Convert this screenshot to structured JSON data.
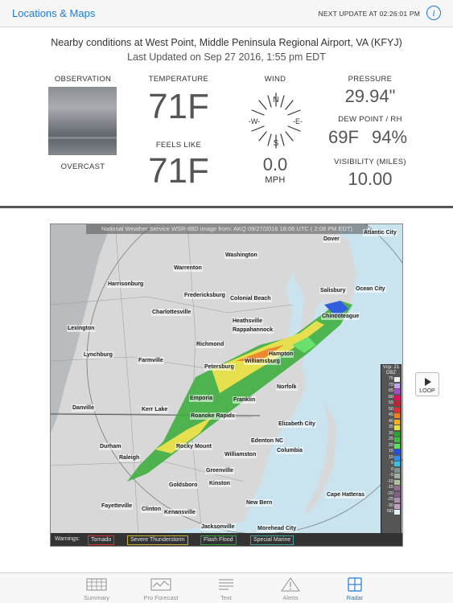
{
  "nav": {
    "back_label": "Locations & Maps",
    "next_update": "NEXT UPDATE AT 02:26:01 PM",
    "info_glyph": "i"
  },
  "conditions": {
    "title": "Nearby conditions at West Point, Middle Peninsula Regional Airport, VA (KFYJ)",
    "last_updated": "Last Updated on Sep 27 2016, 1:55 pm EDT",
    "observation": {
      "label": "OBSERVATION",
      "value": "OVERCAST"
    },
    "temperature": {
      "label": "TEMPERATURE",
      "value": "71F"
    },
    "feels_like": {
      "label": "FEELS LIKE",
      "value": "71F"
    },
    "wind": {
      "label": "WIND",
      "speed": "0.0",
      "unit": "MPH",
      "n": "N",
      "s": "S",
      "e": "-E-",
      "w": "-W-"
    },
    "pressure": {
      "label": "PRESSURE",
      "value": "29.94\""
    },
    "dew_point": {
      "label": "DEW POINT / RH",
      "value": "69F",
      "rh": "94%"
    },
    "visibility": {
      "label": "VISIBILITY (MILES)",
      "value": "10.00"
    }
  },
  "radar": {
    "header": "National Weather Service WSR-88D image from: AKQ 09/27/2016 18:06 UTC ( 2:08 PM EDT)",
    "places": [
      "Dover",
      "Atlantic City",
      "Warrenton",
      "Washington",
      "Harrisonburg",
      "Fredericksburg",
      "Colonial Beach",
      "Salisbury",
      "Ocean City",
      "Charlottesville",
      "Lexington",
      "Heathsville",
      "Rappahannock",
      "Chincoteague",
      "Lynchburg",
      "Farmville",
      "Richmond",
      "Petersburg",
      "Williamsburg",
      "Hampton",
      "Norfolk",
      "Emporia",
      "Franklin",
      "Danville",
      "Kerr Lake",
      "Roanoke Rapids",
      "Elizabeth City",
      "Durham",
      "Raleigh",
      "Rocky Mount",
      "Edenton NC",
      "Columbia",
      "Williamston",
      "Greenville",
      "Kinston",
      "Goldsboro",
      "Cape Hatteras",
      "Fayetteville",
      "Clinton",
      "Kenansville",
      "New Bern",
      "Jacksonville",
      "Morehead City"
    ],
    "legend_title": "Vcp: 21 DBZ",
    "legend": [
      {
        "v": "75",
        "c": "#f0f0f0"
      },
      {
        "v": "70",
        "c": "#c8a0e8"
      },
      {
        "v": "65",
        "c": "#a050c8"
      },
      {
        "v": "60",
        "c": "#e01060"
      },
      {
        "v": "55",
        "c": "#c02030"
      },
      {
        "v": "50",
        "c": "#e03030"
      },
      {
        "v": "45",
        "c": "#f08020"
      },
      {
        "v": "40",
        "c": "#f0b020"
      },
      {
        "v": "35",
        "c": "#e8e040"
      },
      {
        "v": "30",
        "c": "#30a030"
      },
      {
        "v": "25",
        "c": "#40c040"
      },
      {
        "v": "20",
        "c": "#60e060"
      },
      {
        "v": "15",
        "c": "#2050e0"
      },
      {
        "v": "10",
        "c": "#3090f0"
      },
      {
        "v": "5",
        "c": "#40c0e0"
      },
      {
        "v": "0",
        "c": "#809090"
      },
      {
        "v": "-5",
        "c": "#a0b0a0"
      },
      {
        "v": "-10",
        "c": "#b0c0a0"
      },
      {
        "v": "-15",
        "c": "#907090"
      },
      {
        "v": "-20",
        "c": "#806080"
      },
      {
        "v": "-25",
        "c": "#b090b0"
      },
      {
        "v": "-30",
        "c": "#c0a0c0"
      },
      {
        "v": "ND",
        "c": "#e0f0f8"
      }
    ],
    "warnings_label": "Warnings:",
    "warnings": [
      {
        "label": "Tornado",
        "color": "#e03030"
      },
      {
        "label": "Severe Thunderstorm",
        "color": "#d0b030"
      },
      {
        "label": "Flash Flood",
        "color": "#30a030"
      },
      {
        "label": "Special Marine",
        "color": "#40a0a0"
      }
    ]
  },
  "loop": {
    "label": "LOOP"
  },
  "tabs": [
    {
      "label": "Summary",
      "icon": "summary-grid-icon"
    },
    {
      "label": "Pro Forecast",
      "icon": "pro-forecast-chart-icon"
    },
    {
      "label": "Text",
      "icon": "text-lines-icon"
    },
    {
      "label": "Alerts",
      "icon": "alert-triangle-icon"
    },
    {
      "label": "Radar",
      "icon": "radar-grid-icon",
      "active": true
    }
  ],
  "colors": {
    "accent": "#1a7bd6"
  }
}
